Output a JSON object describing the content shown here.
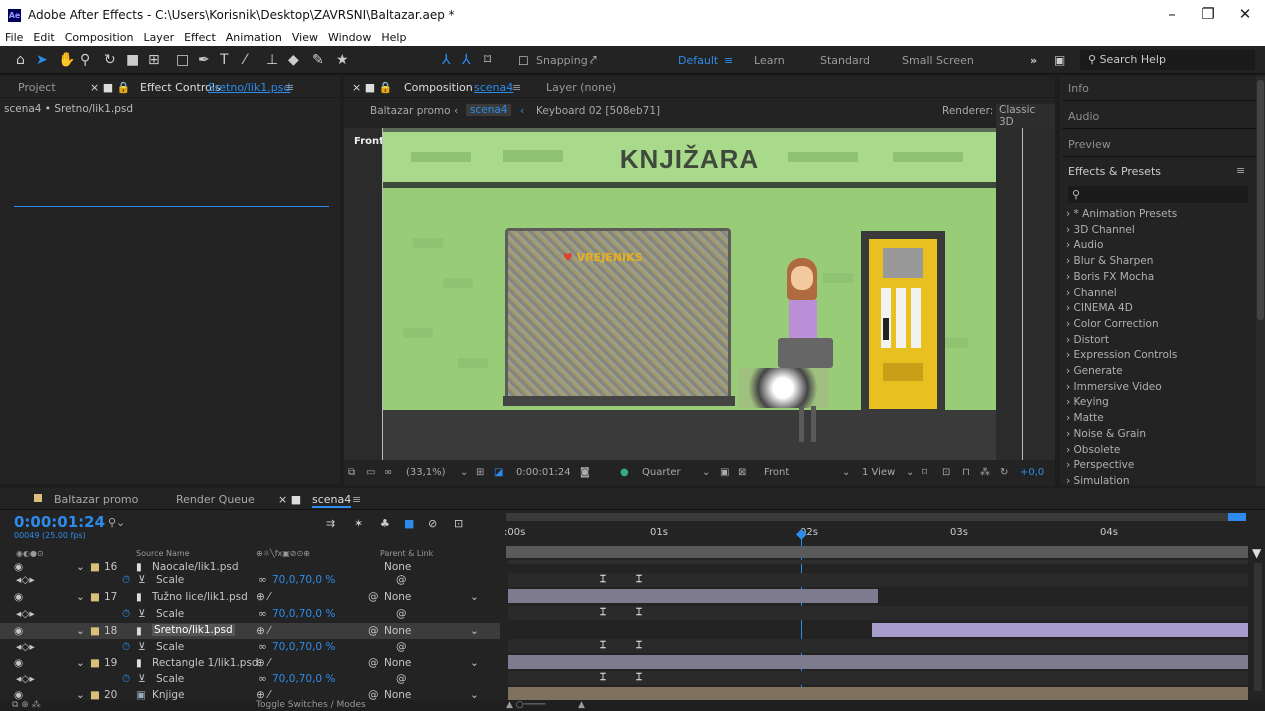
{
  "window": {
    "app_icon": "Ae",
    "title": "Adobe After Effects - C:\\Users\\Korisnik\\Desktop\\ZAVRSNI\\Baltazar.aep *",
    "minimize": "–",
    "maximize": "❐",
    "close": "✕"
  },
  "menu": [
    "File",
    "Edit",
    "Composition",
    "Layer",
    "Effect",
    "Animation",
    "View",
    "Window",
    "Help"
  ],
  "toolbar": {
    "snapping_label": "Snapping",
    "workspaces": [
      "Default",
      "Learn",
      "Standard",
      "Small Screen"
    ],
    "more": "»",
    "search_placeholder": "Search Help"
  },
  "project_panel": {
    "tab_project": "Project",
    "tab_effect_controls_prefix": "Effect Controls",
    "tab_effect_controls_layer": "Sretno/lik1.psd",
    "subtitle": "scena4 • Sretno/lik1.psd"
  },
  "comp_panel": {
    "tab_prefix": "Composition",
    "tab_comp": "scena4",
    "layer_tab": "Layer (none)",
    "breadcrumbs": [
      "Baltazar promo",
      "scena4",
      "Keyboard 02 [508eb71]"
    ],
    "renderer_label": "Renderer:",
    "renderer_value": "Classic 3D",
    "view_label": "Front",
    "scene_sign": "KNJIŽARA",
    "shop_sign": "VREJENIKS",
    "zoom": "(33,1%)",
    "timecode": "0:00:01:24",
    "resolution": "Quarter",
    "camera": "Front",
    "views": "1 View",
    "exposure": "+0,0"
  },
  "right_panel": {
    "items": [
      "Info",
      "Audio",
      "Preview",
      "Effects & Presets"
    ],
    "effects": [
      "* Animation Presets",
      "3D Channel",
      "Audio",
      "Blur & Sharpen",
      "Boris FX Mocha",
      "Channel",
      "CINEMA 4D",
      "Color Correction",
      "Distort",
      "Expression Controls",
      "Generate",
      "Immersive Video",
      "Keying",
      "Matte",
      "Noise & Grain",
      "Obsolete",
      "Perspective",
      "Simulation"
    ]
  },
  "timeline": {
    "tabs": [
      "Baltazar promo",
      "Render Queue",
      "scena4"
    ],
    "timecode": "0:00:01:24",
    "frames": "00049 (25.00 fps)",
    "col_source": "Source Name",
    "col_parent": "Parent & Link",
    "ruler": [
      ":00s",
      "01s",
      "02s",
      "03s",
      "04s"
    ],
    "footer": "Toggle Switches / Modes",
    "rows": [
      {
        "num": "16",
        "name": "Naocale/lik1.psd",
        "parent": "None",
        "type": "layer"
      },
      {
        "num": "",
        "name": "Scale",
        "value": "70,0,70,0 %",
        "type": "prop"
      },
      {
        "num": "17",
        "name": "Tužno lice/lik1.psd",
        "parent": "None",
        "type": "layer"
      },
      {
        "num": "",
        "name": "Scale",
        "value": "70,0,70,0 %",
        "type": "prop"
      },
      {
        "num": "18",
        "name": "Sretno/lik1.psd",
        "parent": "None",
        "type": "layer",
        "selected": true
      },
      {
        "num": "",
        "name": "Scale",
        "value": "70,0,70,0 %",
        "type": "prop"
      },
      {
        "num": "19",
        "name": "Rectangle 1/lik1.psd",
        "parent": "None",
        "type": "layer"
      },
      {
        "num": "",
        "name": "Scale",
        "value": "70,0,70,0 %",
        "type": "prop"
      },
      {
        "num": "20",
        "name": "Knjige",
        "parent": "None",
        "type": "layer"
      }
    ]
  },
  "colors": {
    "accent": "#2d8ceb",
    "label_yellow": "#d9c07a",
    "panel_bg": "#232323",
    "scene_bg": "#99cc77"
  }
}
